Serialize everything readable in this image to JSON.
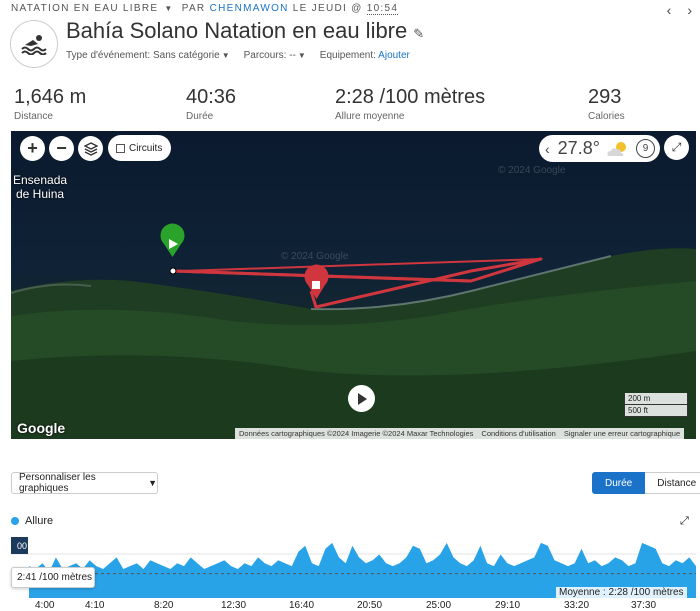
{
  "header": {
    "activity_type": "NATATION EN EAU LIBRE",
    "by": "PAR",
    "author": "CHENMAWON",
    "when": "LE JEUDI @",
    "time": "10:54",
    "title": "Bahía Solano Natation en eau libre"
  },
  "meta": {
    "event_type_label": "Type d'événement:",
    "event_type_value": "Sans catégorie",
    "course_label": "Parcours:",
    "course_value": "--",
    "equipment_label": "Equipement:",
    "equipment_link": "Ajouter"
  },
  "stats": [
    {
      "value": "1,646 m",
      "label": "Distance"
    },
    {
      "value": "40:36",
      "label": "Durée"
    },
    {
      "value": "2:28 /100 mètres",
      "label": "Allure moyenne"
    },
    {
      "value": "293",
      "label": "Calories"
    }
  ],
  "map": {
    "circuits_label": "Circuits",
    "temperature": "27.8°",
    "wind": "9",
    "place_line1": "Ensenada",
    "place_line2": "de Huina",
    "watermark1": "© 2024 Google",
    "watermark2": "© 2024 Google",
    "google_logo": "Google",
    "scale_m": "200 m",
    "scale_ft": "500 ft",
    "attribution": [
      "Données cartographiques ©2024 Imagerie ©2024 Maxar Technologies",
      "Conditions d'utilisation",
      "Signaler une erreur cartographique"
    ]
  },
  "controls": {
    "customize_label": "Personnaliser les graphiques",
    "toggle": [
      "Durée",
      "Distance"
    ]
  },
  "chart_data": {
    "type": "area",
    "series": [
      {
        "name": "Allure"
      }
    ],
    "color": "#29a3e8",
    "x_ticks": [
      "4:00",
      "4:10",
      "8:20",
      "12:30",
      "16:40",
      "20:50",
      "25:00",
      "29:10",
      "33:20",
      "37:30"
    ],
    "y_tick_top": "00",
    "tooltip": "2:41 /100 mètres",
    "average_label": "Moyenne : 2:28 /100 mètres",
    "values": [
      0.55,
      0.5,
      0.6,
      0.45,
      0.7,
      0.5,
      0.55,
      0.6,
      0.5,
      0.65,
      0.55,
      0.5,
      0.6,
      0.7,
      0.5,
      0.55,
      0.6,
      0.5,
      0.65,
      0.6,
      0.55,
      0.5,
      0.6,
      0.55,
      0.7,
      0.6,
      0.5,
      0.55,
      0.6,
      0.65,
      0.55,
      0.5,
      0.6,
      0.55,
      0.7,
      0.6,
      0.55,
      0.65,
      0.6,
      0.55,
      0.8,
      0.9,
      0.6,
      0.55,
      0.85,
      0.95,
      0.7,
      0.6,
      0.9,
      0.7,
      0.6,
      0.65,
      0.75,
      0.6,
      0.55,
      0.6,
      0.7,
      0.9,
      0.85,
      0.6,
      0.65,
      0.75,
      0.95,
      0.7,
      0.6,
      0.55,
      0.65,
      0.9,
      0.6,
      0.55,
      0.75,
      0.6,
      0.55,
      0.6,
      0.65,
      0.7,
      0.95,
      0.9,
      0.65,
      0.6,
      0.55,
      0.6,
      0.85,
      0.6,
      0.65,
      0.55,
      0.6,
      0.7,
      0.65,
      0.55,
      0.6,
      0.95,
      0.9,
      0.85,
      0.6,
      0.55,
      0.65,
      0.6,
      0.7,
      0.55
    ]
  }
}
